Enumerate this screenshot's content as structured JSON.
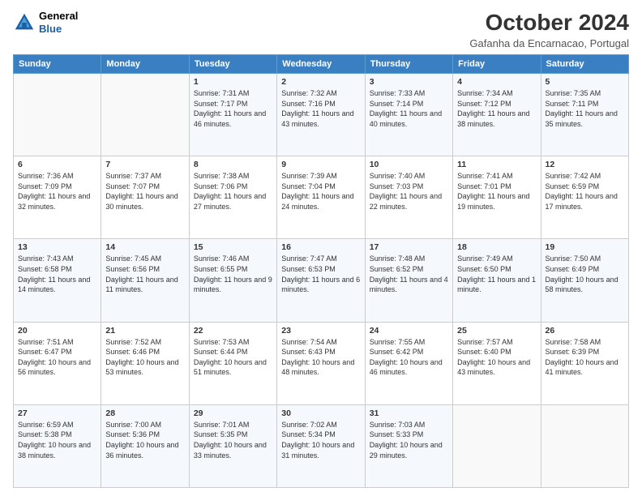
{
  "header": {
    "logo": {
      "general": "General",
      "blue": "Blue"
    },
    "title": "October 2024",
    "subtitle": "Gafanha da Encarnacao, Portugal"
  },
  "weekdays": [
    "Sunday",
    "Monday",
    "Tuesday",
    "Wednesday",
    "Thursday",
    "Friday",
    "Saturday"
  ],
  "weeks": [
    [
      {
        "day": "",
        "sunrise": "",
        "sunset": "",
        "daylight": ""
      },
      {
        "day": "",
        "sunrise": "",
        "sunset": "",
        "daylight": ""
      },
      {
        "day": "1",
        "sunrise": "Sunrise: 7:31 AM",
        "sunset": "Sunset: 7:17 PM",
        "daylight": "Daylight: 11 hours and 46 minutes."
      },
      {
        "day": "2",
        "sunrise": "Sunrise: 7:32 AM",
        "sunset": "Sunset: 7:16 PM",
        "daylight": "Daylight: 11 hours and 43 minutes."
      },
      {
        "day": "3",
        "sunrise": "Sunrise: 7:33 AM",
        "sunset": "Sunset: 7:14 PM",
        "daylight": "Daylight: 11 hours and 40 minutes."
      },
      {
        "day": "4",
        "sunrise": "Sunrise: 7:34 AM",
        "sunset": "Sunset: 7:12 PM",
        "daylight": "Daylight: 11 hours and 38 minutes."
      },
      {
        "day": "5",
        "sunrise": "Sunrise: 7:35 AM",
        "sunset": "Sunset: 7:11 PM",
        "daylight": "Daylight: 11 hours and 35 minutes."
      }
    ],
    [
      {
        "day": "6",
        "sunrise": "Sunrise: 7:36 AM",
        "sunset": "Sunset: 7:09 PM",
        "daylight": "Daylight: 11 hours and 32 minutes."
      },
      {
        "day": "7",
        "sunrise": "Sunrise: 7:37 AM",
        "sunset": "Sunset: 7:07 PM",
        "daylight": "Daylight: 11 hours and 30 minutes."
      },
      {
        "day": "8",
        "sunrise": "Sunrise: 7:38 AM",
        "sunset": "Sunset: 7:06 PM",
        "daylight": "Daylight: 11 hours and 27 minutes."
      },
      {
        "day": "9",
        "sunrise": "Sunrise: 7:39 AM",
        "sunset": "Sunset: 7:04 PM",
        "daylight": "Daylight: 11 hours and 24 minutes."
      },
      {
        "day": "10",
        "sunrise": "Sunrise: 7:40 AM",
        "sunset": "Sunset: 7:03 PM",
        "daylight": "Daylight: 11 hours and 22 minutes."
      },
      {
        "day": "11",
        "sunrise": "Sunrise: 7:41 AM",
        "sunset": "Sunset: 7:01 PM",
        "daylight": "Daylight: 11 hours and 19 minutes."
      },
      {
        "day": "12",
        "sunrise": "Sunrise: 7:42 AM",
        "sunset": "Sunset: 6:59 PM",
        "daylight": "Daylight: 11 hours and 17 minutes."
      }
    ],
    [
      {
        "day": "13",
        "sunrise": "Sunrise: 7:43 AM",
        "sunset": "Sunset: 6:58 PM",
        "daylight": "Daylight: 11 hours and 14 minutes."
      },
      {
        "day": "14",
        "sunrise": "Sunrise: 7:45 AM",
        "sunset": "Sunset: 6:56 PM",
        "daylight": "Daylight: 11 hours and 11 minutes."
      },
      {
        "day": "15",
        "sunrise": "Sunrise: 7:46 AM",
        "sunset": "Sunset: 6:55 PM",
        "daylight": "Daylight: 11 hours and 9 minutes."
      },
      {
        "day": "16",
        "sunrise": "Sunrise: 7:47 AM",
        "sunset": "Sunset: 6:53 PM",
        "daylight": "Daylight: 11 hours and 6 minutes."
      },
      {
        "day": "17",
        "sunrise": "Sunrise: 7:48 AM",
        "sunset": "Sunset: 6:52 PM",
        "daylight": "Daylight: 11 hours and 4 minutes."
      },
      {
        "day": "18",
        "sunrise": "Sunrise: 7:49 AM",
        "sunset": "Sunset: 6:50 PM",
        "daylight": "Daylight: 11 hours and 1 minute."
      },
      {
        "day": "19",
        "sunrise": "Sunrise: 7:50 AM",
        "sunset": "Sunset: 6:49 PM",
        "daylight": "Daylight: 10 hours and 58 minutes."
      }
    ],
    [
      {
        "day": "20",
        "sunrise": "Sunrise: 7:51 AM",
        "sunset": "Sunset: 6:47 PM",
        "daylight": "Daylight: 10 hours and 56 minutes."
      },
      {
        "day": "21",
        "sunrise": "Sunrise: 7:52 AM",
        "sunset": "Sunset: 6:46 PM",
        "daylight": "Daylight: 10 hours and 53 minutes."
      },
      {
        "day": "22",
        "sunrise": "Sunrise: 7:53 AM",
        "sunset": "Sunset: 6:44 PM",
        "daylight": "Daylight: 10 hours and 51 minutes."
      },
      {
        "day": "23",
        "sunrise": "Sunrise: 7:54 AM",
        "sunset": "Sunset: 6:43 PM",
        "daylight": "Daylight: 10 hours and 48 minutes."
      },
      {
        "day": "24",
        "sunrise": "Sunrise: 7:55 AM",
        "sunset": "Sunset: 6:42 PM",
        "daylight": "Daylight: 10 hours and 46 minutes."
      },
      {
        "day": "25",
        "sunrise": "Sunrise: 7:57 AM",
        "sunset": "Sunset: 6:40 PM",
        "daylight": "Daylight: 10 hours and 43 minutes."
      },
      {
        "day": "26",
        "sunrise": "Sunrise: 7:58 AM",
        "sunset": "Sunset: 6:39 PM",
        "daylight": "Daylight: 10 hours and 41 minutes."
      }
    ],
    [
      {
        "day": "27",
        "sunrise": "Sunrise: 6:59 AM",
        "sunset": "Sunset: 5:38 PM",
        "daylight": "Daylight: 10 hours and 38 minutes."
      },
      {
        "day": "28",
        "sunrise": "Sunrise: 7:00 AM",
        "sunset": "Sunset: 5:36 PM",
        "daylight": "Daylight: 10 hours and 36 minutes."
      },
      {
        "day": "29",
        "sunrise": "Sunrise: 7:01 AM",
        "sunset": "Sunset: 5:35 PM",
        "daylight": "Daylight: 10 hours and 33 minutes."
      },
      {
        "day": "30",
        "sunrise": "Sunrise: 7:02 AM",
        "sunset": "Sunset: 5:34 PM",
        "daylight": "Daylight: 10 hours and 31 minutes."
      },
      {
        "day": "31",
        "sunrise": "Sunrise: 7:03 AM",
        "sunset": "Sunset: 5:33 PM",
        "daylight": "Daylight: 10 hours and 29 minutes."
      },
      {
        "day": "",
        "sunrise": "",
        "sunset": "",
        "daylight": ""
      },
      {
        "day": "",
        "sunrise": "",
        "sunset": "",
        "daylight": ""
      }
    ]
  ]
}
